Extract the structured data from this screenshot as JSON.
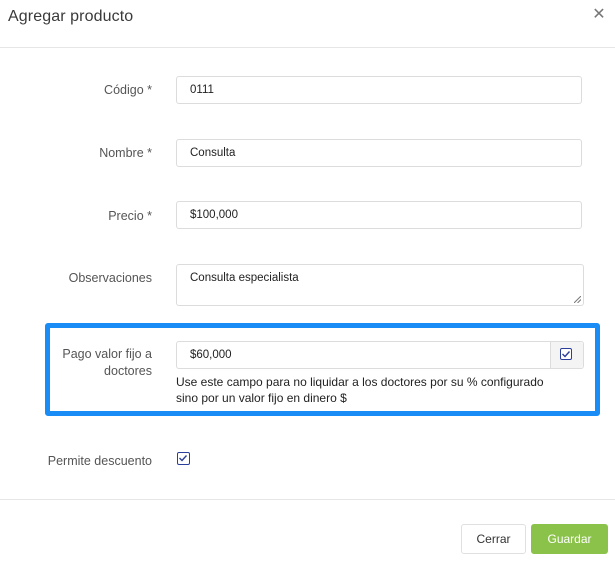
{
  "modal": {
    "title": "Agregar producto",
    "close_icon": "close-icon"
  },
  "form": {
    "codigo": {
      "label": "Código *",
      "value": "0111"
    },
    "nombre": {
      "label": "Nombre *",
      "value": "Consulta"
    },
    "precio": {
      "label": "Precio *",
      "value": "$100,000"
    },
    "observaciones": {
      "label": "Observaciones",
      "value": "Consulta especialista"
    },
    "pago_fijo": {
      "label_line1": "Pago valor fijo a",
      "label_line2": "doctores",
      "value": "$60,000",
      "checked": true,
      "help_line1": "Use este campo para no liquidar a los doctores por su % configurado",
      "help_line2": "sino por un valor fijo en dinero $"
    },
    "permite_descuento": {
      "label": "Permite descuento",
      "checked": true
    }
  },
  "footer": {
    "close_label": "Cerrar",
    "save_label": "Guardar"
  },
  "colors": {
    "highlight": "#1a8cf5",
    "save_button": "#8bc34a",
    "checkbox": "#2b3f9a"
  }
}
